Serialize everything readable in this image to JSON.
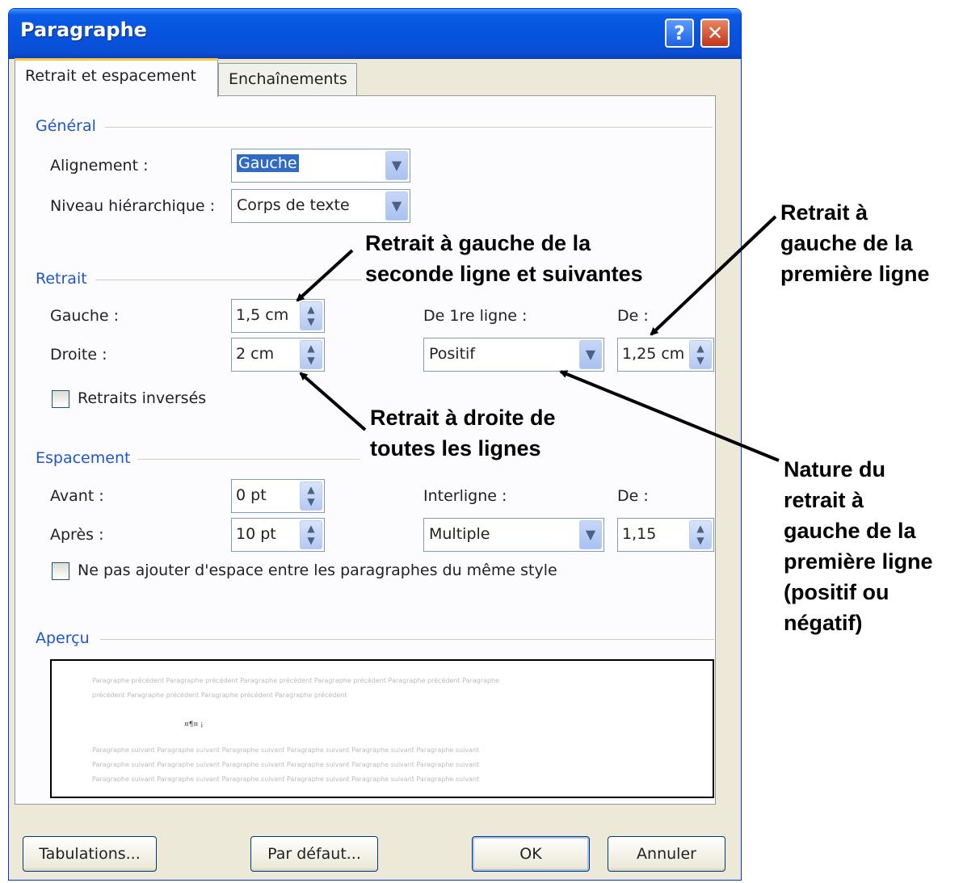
{
  "window": {
    "title": "Paragraphe",
    "help": "?",
    "close": "✕"
  },
  "tabs": [
    {
      "label": "Retrait et espacement",
      "active": true
    },
    {
      "label": "Enchaînements",
      "active": false
    }
  ],
  "general": {
    "title": "Général",
    "alignment_label": "Alignement :",
    "alignment_value": "Gauche",
    "level_label": "Niveau hiérarchique :",
    "level_value": "Corps de texte"
  },
  "indent": {
    "title": "Retrait",
    "left_label": "Gauche :",
    "left_value": "1,5 cm",
    "right_label": "Droite :",
    "right_value": "2 cm",
    "first_line_label": "De 1re ligne :",
    "first_line_value": "Positif",
    "by_label": "De :",
    "by_value": "1,25 cm",
    "mirror_label": "Retraits inversés"
  },
  "spacing": {
    "title": "Espacement",
    "before_label": "Avant :",
    "before_value": "0 pt",
    "after_label": "Après :",
    "after_value": "10 pt",
    "line_label": "Interligne :",
    "line_value": "Multiple",
    "at_label": "De :",
    "at_value": "1,15",
    "no_space_label": "Ne pas ajouter d'espace entre les paragraphes du même style"
  },
  "preview": {
    "title": "Aperçu",
    "prev_line1": "Paragraphe précédent Paragraphe précédent Paragraphe précédent Paragraphe précédent Paragraphe précédent Paragraphe",
    "prev_line2": "précédent Paragraphe précédent Paragraphe précédent Paragraphe précédent",
    "current": "¤¶¤ ¡",
    "next_line": "Paragraphe suivant Paragraphe suivant Paragraphe suivant Paragraphe suivant Paragraphe suivant Paragraphe suivant"
  },
  "buttons": {
    "tabs": "Tabulations...",
    "default": "Par défaut...",
    "ok": "OK",
    "cancel": "Annuler"
  },
  "annotations": {
    "left_second": [
      "Retrait à gauche de la",
      "seconde ligne et suivantes"
    ],
    "right_all": [
      "Retrait à droite de",
      "toutes les lignes"
    ],
    "first_line": [
      "Retrait à",
      "gauche de la",
      "première ligne"
    ],
    "nature": [
      "Nature du",
      "retrait à",
      "gauche de la",
      "première ligne",
      "(positif ou",
      "négatif)"
    ]
  },
  "icons": {
    "arrow": "chevron-down-icon",
    "spin": "spin-icon"
  }
}
